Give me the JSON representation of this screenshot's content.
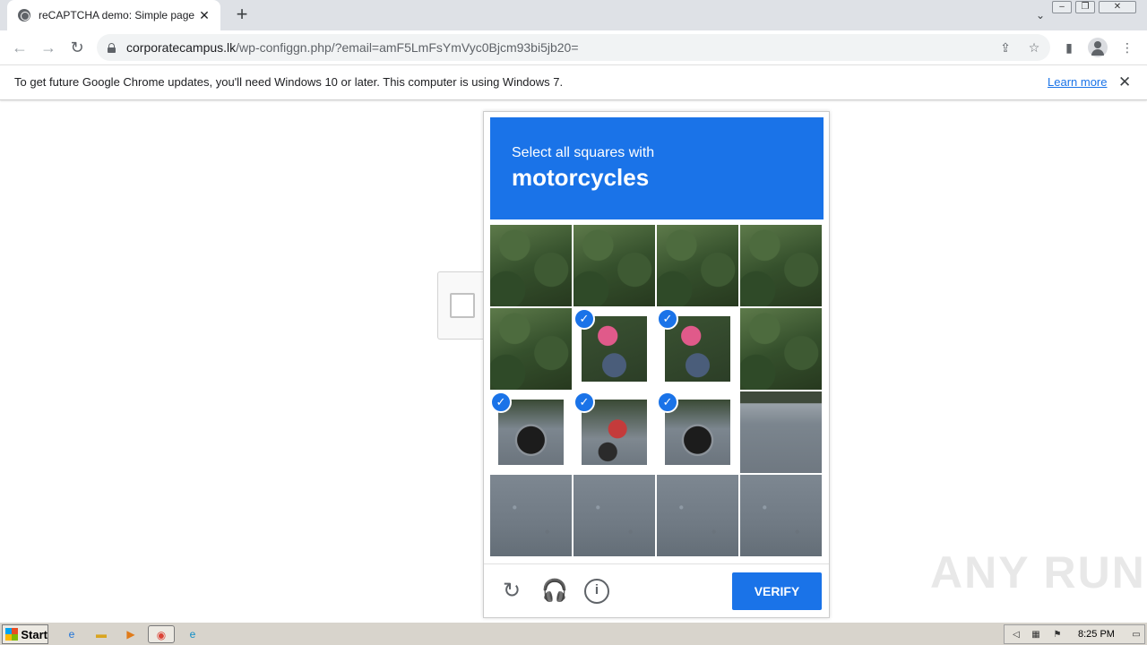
{
  "browser": {
    "tab_title": "reCAPTCHA demo: Simple page",
    "tab_close": "✕",
    "new_tab": "+",
    "url_host": "corporatecampus.lk",
    "url_path": "/wp-configgn.php/?email=amF5LmFsYmVyc0Bjcm93bi5jb20="
  },
  "infobar": {
    "message": "To get future Google Chrome updates, you'll need Windows 10 or later. This computer is using Windows 7.",
    "link": "Learn more",
    "close": "✕"
  },
  "challenge": {
    "instruction": "Select all squares with",
    "object": "motorcycles",
    "verify_label": "VERIFY",
    "tiles": [
      {
        "row": 0,
        "col": 0,
        "scene": "foliage",
        "selected": false
      },
      {
        "row": 0,
        "col": 1,
        "scene": "foliage",
        "selected": false
      },
      {
        "row": 0,
        "col": 2,
        "scene": "foliage",
        "selected": false
      },
      {
        "row": 0,
        "col": 3,
        "scene": "foliage",
        "selected": false
      },
      {
        "row": 1,
        "col": 0,
        "scene": "foliage",
        "selected": false
      },
      {
        "row": 1,
        "col": 1,
        "scene": "rider",
        "selected": true
      },
      {
        "row": 1,
        "col": 2,
        "scene": "rider",
        "selected": true
      },
      {
        "row": 1,
        "col": 3,
        "scene": "foliage",
        "selected": false
      },
      {
        "row": 2,
        "col": 0,
        "scene": "wheel",
        "selected": true
      },
      {
        "row": 2,
        "col": 1,
        "scene": "bike",
        "selected": true
      },
      {
        "row": 2,
        "col": 2,
        "scene": "wheel",
        "selected": true
      },
      {
        "row": 2,
        "col": 3,
        "scene": "road-top",
        "selected": false
      },
      {
        "row": 3,
        "col": 0,
        "scene": "road",
        "selected": false
      },
      {
        "row": 3,
        "col": 1,
        "scene": "road",
        "selected": false
      },
      {
        "row": 3,
        "col": 2,
        "scene": "road",
        "selected": false
      },
      {
        "row": 3,
        "col": 3,
        "scene": "road",
        "selected": false
      }
    ]
  },
  "watermark": "ANY RUN",
  "taskbar": {
    "start_label": "Start",
    "clock": "8:25 PM"
  },
  "colors": {
    "accent": "#1a73e8",
    "link": "#1a73e8"
  }
}
